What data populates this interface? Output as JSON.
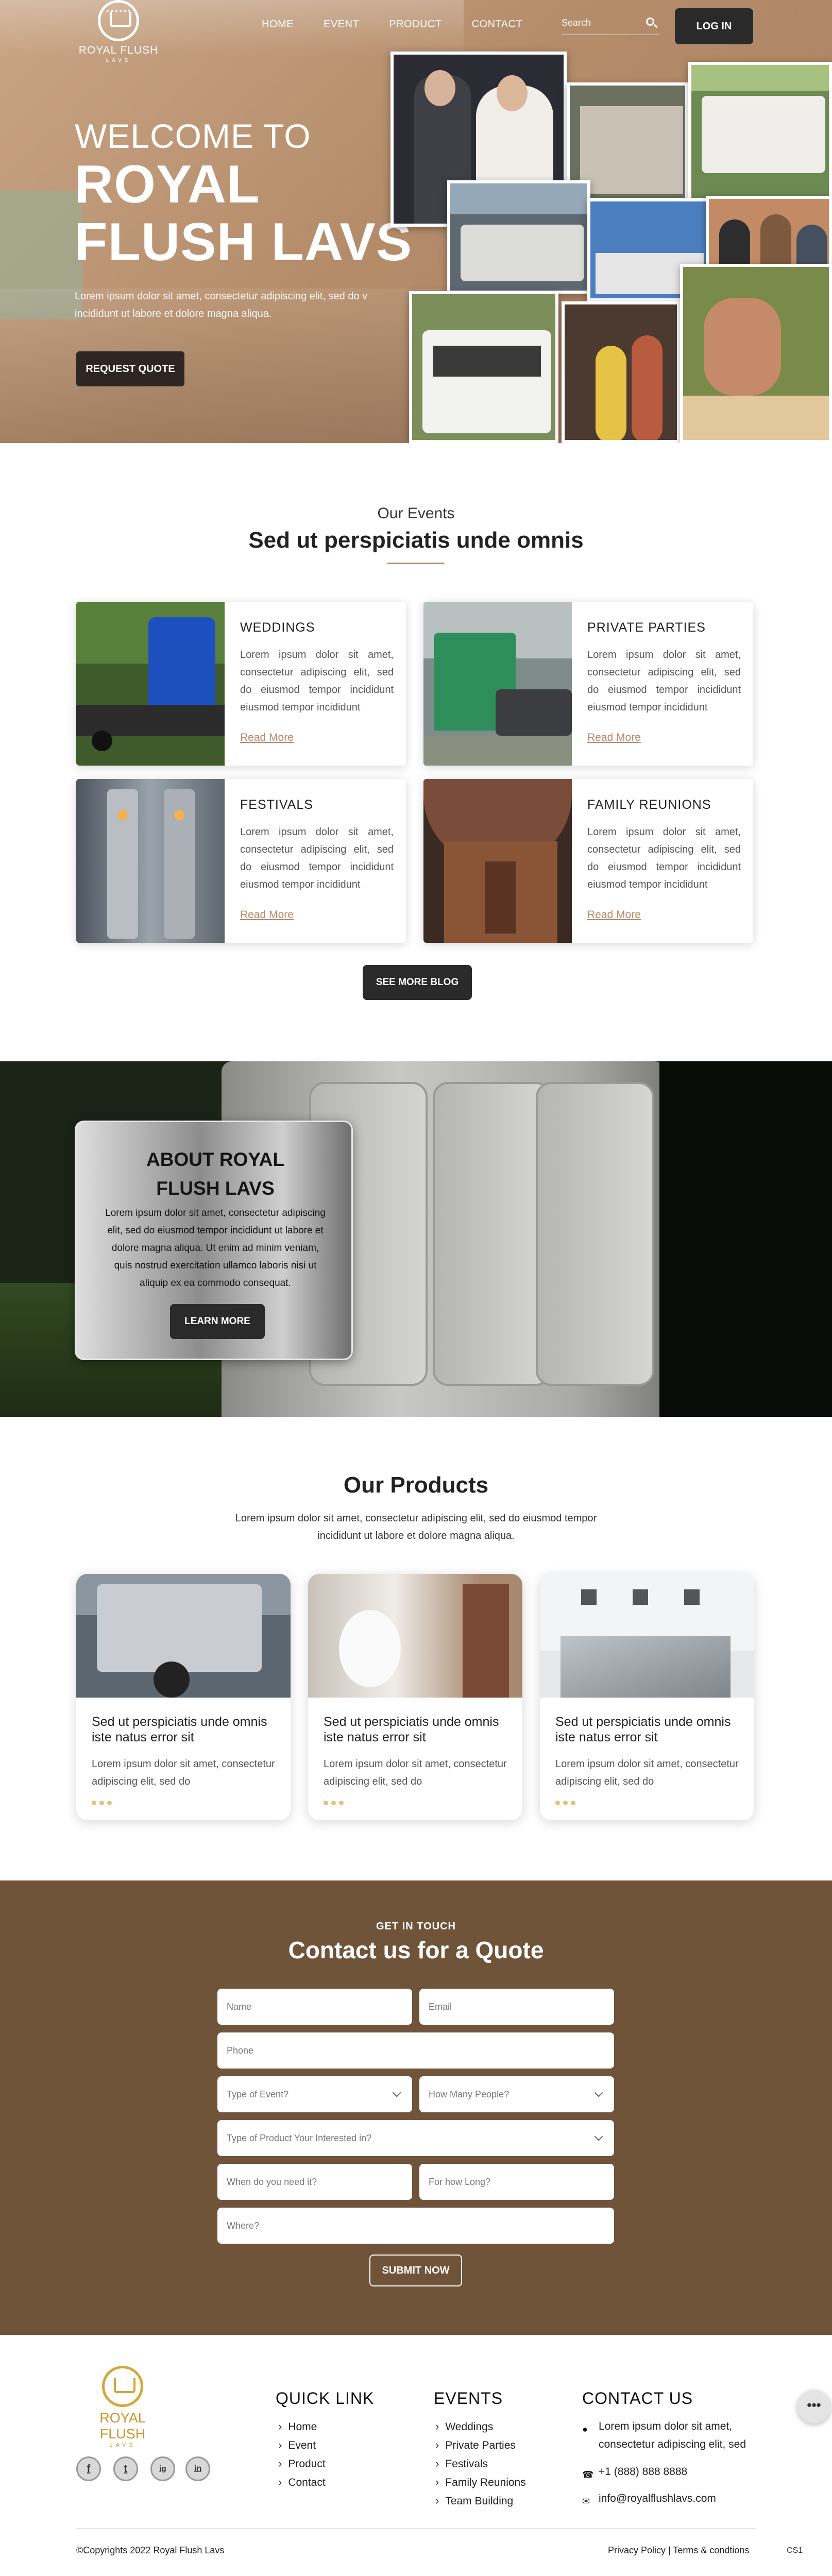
{
  "header": {
    "logo_name": "ROYAL FLUSH",
    "logo_sub": "LAVS",
    "nav": [
      "HOME",
      "EVENT",
      "PRODUCT",
      "CONTACT"
    ],
    "search_placeholder": "Search",
    "login_label": "LOG IN"
  },
  "hero": {
    "welcome": "WELCOME TO",
    "line1": "ROYAL",
    "line2": "FLUSH LAVS",
    "subtitle": "Lorem ipsum dolor sit amet, consectetur adipiscing elit, sed do v incididunt ut labore et dolore magna aliqua.",
    "quote_label": "REQUEST QUOTE"
  },
  "events": {
    "eyebrow": "Our Events",
    "title": "Sed ut perspiciatis unde omnis",
    "cards": [
      {
        "title": "WEDDINGS",
        "desc": "Lorem ipsum dolor sit amet, consectetur adipiscing elit, sed do eiusmod tempor incididunt eiusmod tempor incididunt",
        "more": "Read More"
      },
      {
        "title": "PRIVATE PARTIES",
        "desc": "Lorem ipsum dolor sit amet, consectetur adipiscing elit, sed do eiusmod tempor incididunt eiusmod tempor incididunt",
        "more": "Read More"
      },
      {
        "title": "FESTIVALS",
        "desc": "Lorem ipsum dolor sit amet, consectetur adipiscing elit, sed do eiusmod tempor incididunt eiusmod tempor incididunt",
        "more": "Read More"
      },
      {
        "title": "FAMILY REUNIONS",
        "desc": "Lorem ipsum dolor sit amet, consectetur adipiscing elit, sed do eiusmod tempor incididunt eiusmod tempor incididunt",
        "more": "Read More"
      }
    ],
    "more_label": "SEE MORE BLOG"
  },
  "about": {
    "title_l1": "ABOUT ROYAL",
    "title_l2": "FLUSH LAVS",
    "desc": "Lorem ipsum dolor sit amet, consectetur adipiscing elit, sed do eiusmod tempor incididunt ut labore et dolore magna aliqua. Ut enim ad minim veniam, quis nostrud exercitation ullamco laboris nisi ut aliquip ex ea commodo consequat.",
    "learn_label": "LEARN MORE"
  },
  "products": {
    "title": "Our Products",
    "desc": "Lorem ipsum dolor sit amet, consectetur adipiscing elit, sed do eiusmod tempor incididunt ut labore et dolore magna aliqua.",
    "items": [
      {
        "title": "Sed ut perspiciatis unde omnis iste natus error sit",
        "desc": "Lorem ipsum dolor sit amet, consectetur adipiscing elit, sed do"
      },
      {
        "title": "Sed ut perspiciatis unde omnis iste natus error sit",
        "desc": "Lorem ipsum dolor sit amet, consectetur adipiscing elit, sed do"
      },
      {
        "title": "Sed ut perspiciatis unde omnis iste natus error sit",
        "desc": "Lorem ipsum dolor sit amet, consectetur adipiscing elit, sed do"
      }
    ]
  },
  "contact": {
    "eyebrow": "GET IN TOUCH",
    "title": "Contact us for a Quote",
    "name": "Name",
    "email": "Email",
    "phone": "Phone",
    "event_type": "Type of Event?",
    "people": "How Many People?",
    "product_type": "Type of Product Your Interested in?",
    "when": "When do you need it?",
    "how_long": "For how Long?",
    "where": "Where?",
    "submit_label": "SUBMIT NOW"
  },
  "footer": {
    "logo_name": "ROYAL FLUSH",
    "logo_sub": "LAVS",
    "social": [
      "f",
      "t",
      "ig",
      "in"
    ],
    "quick_title": "QUICK LINK",
    "quick_links": [
      "Home",
      "Event",
      "Product",
      "Contact"
    ],
    "events_title": "EVENTS",
    "events_links": [
      "Weddings",
      "Private Parties",
      "Festivals",
      "Family Reunions",
      "Team Building"
    ],
    "contact_title": "CONTACT US",
    "address": "Lorem ipsum dolor sit amet, consectetur adipiscing elit, sed",
    "phone": "+1 (888) 888 8888",
    "email": "info@royalflushlavs.com",
    "copyright": "©Copyrights 2022 Royal Flush Lavs",
    "legal": "Privacy Policy | Terms & condtions",
    "cs": "CS1",
    "chat_glyph": "•••"
  },
  "colors": {
    "accent": "#b5896a",
    "contact_bg": "#6f543a",
    "dark_button": "#2a2a2a",
    "logo_gold": "#c9962a"
  }
}
